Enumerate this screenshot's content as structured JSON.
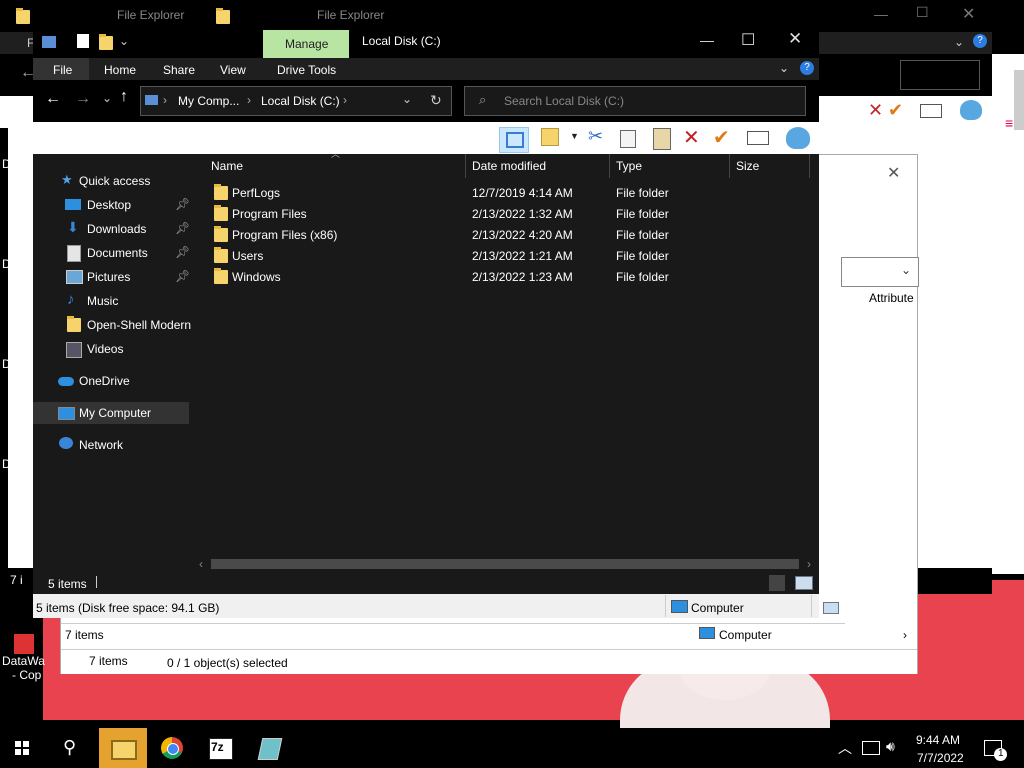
{
  "back_window": {
    "title": "File Explorer",
    "file_menu_letter": "F",
    "status_items_1": "7 items",
    "status_items_2": "7 i",
    "status_items_3": "7 i",
    "status_computer": "Computer",
    "status_selection": "0 / 1 object(s) selected",
    "attribute_header": "Attribute",
    "side_letters": [
      "D",
      "D",
      "D",
      "D"
    ]
  },
  "desktop": {
    "icon_label_line1": "DataWa",
    "icon_label_line2": "- Cop"
  },
  "titlebar": {
    "title": "Local Disk (C:)",
    "manage_tab": "Manage"
  },
  "ribbon": {
    "tabs": [
      "File",
      "Home",
      "Share",
      "View",
      "Drive Tools"
    ]
  },
  "addressbar": {
    "crumbs": [
      "My Comp...",
      "Local Disk (C:)"
    ],
    "search_placeholder": "Search Local Disk (C:)"
  },
  "nav": {
    "items": [
      {
        "label": "Quick access",
        "icon": "star-icon"
      },
      {
        "label": "Desktop",
        "icon": "desktop-icon",
        "pinned": true
      },
      {
        "label": "Downloads",
        "icon": "download-icon",
        "pinned": true
      },
      {
        "label": "Documents",
        "icon": "documents-icon",
        "pinned": true
      },
      {
        "label": "Pictures",
        "icon": "pictures-icon",
        "pinned": true
      },
      {
        "label": "Music",
        "icon": "music-icon"
      },
      {
        "label": "Open-Shell Modern",
        "icon": "folder-icon"
      },
      {
        "label": "Videos",
        "icon": "videos-icon"
      },
      {
        "label": "OneDrive",
        "icon": "onedrive-icon"
      },
      {
        "label": "My Computer",
        "icon": "computer-icon",
        "selected": true
      },
      {
        "label": "Network",
        "icon": "network-icon"
      }
    ]
  },
  "columns": {
    "name": "Name",
    "date": "Date modified",
    "type": "Type",
    "size": "Size"
  },
  "files": [
    {
      "name": "PerfLogs",
      "date": "12/7/2019 4:14 AM",
      "type": "File folder"
    },
    {
      "name": "Program Files",
      "date": "2/13/2022 1:32 AM",
      "type": "File folder"
    },
    {
      "name": "Program Files (x86)",
      "date": "2/13/2022 4:20 AM",
      "type": "File folder"
    },
    {
      "name": "Users",
      "date": "2/13/2022 1:21 AM",
      "type": "File folder"
    },
    {
      "name": "Windows",
      "date": "2/13/2022 1:23 AM",
      "type": "File folder"
    }
  ],
  "statusbar": {
    "items": "5 items",
    "disk_info": "5 items (Disk free space: 94.1 GB)",
    "computer": "Computer"
  },
  "taskbar": {
    "time": "9:44 AM",
    "date": "7/7/2022",
    "notification_count": "1",
    "sevenzip_label": "7z"
  },
  "colors": {
    "manage_tab": "#b9e5a3",
    "desktop_red": "#e8434f",
    "selected_nav": "#333333"
  }
}
